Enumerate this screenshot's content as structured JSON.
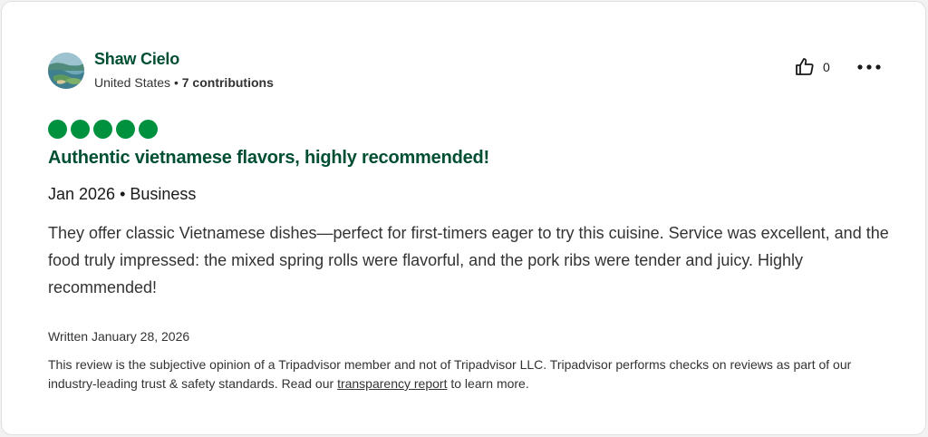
{
  "colors": {
    "brand_green": "#004f32",
    "bubble_green": "#00913f",
    "text": "#333333",
    "card_bg": "#ffffff"
  },
  "reviewer": {
    "name": "Shaw Cielo",
    "location": "United States",
    "separator": " • ",
    "contributions": "7 contributions",
    "avatar_icon": "avatar-landscape-photo"
  },
  "actions": {
    "helpful_icon": "thumbs-up-icon",
    "helpful_count": "0",
    "more_icon": "more-horizontal-icon"
  },
  "review": {
    "rating": 5,
    "rating_max": 5,
    "title": "Authentic vietnamese flavors, highly recommended!",
    "trip_info": "Jan 2026 • Business",
    "body": "They offer classic Vietnamese dishes—perfect for first-timers eager to try this cuisine. Service was excellent, and the food truly impressed: the mixed spring rolls were flavorful, and the pork ribs were tender and juicy. Highly recommended!",
    "written_date": "Written January 28, 2026"
  },
  "disclaimer": {
    "text_before": "This review is the subjective opinion of a Tripadvisor member and not of Tripadvisor LLC. Tripadvisor performs checks on reviews as part of our industry-leading trust & safety standards. Read our ",
    "link_text": "transparency report",
    "text_after": " to learn more."
  }
}
